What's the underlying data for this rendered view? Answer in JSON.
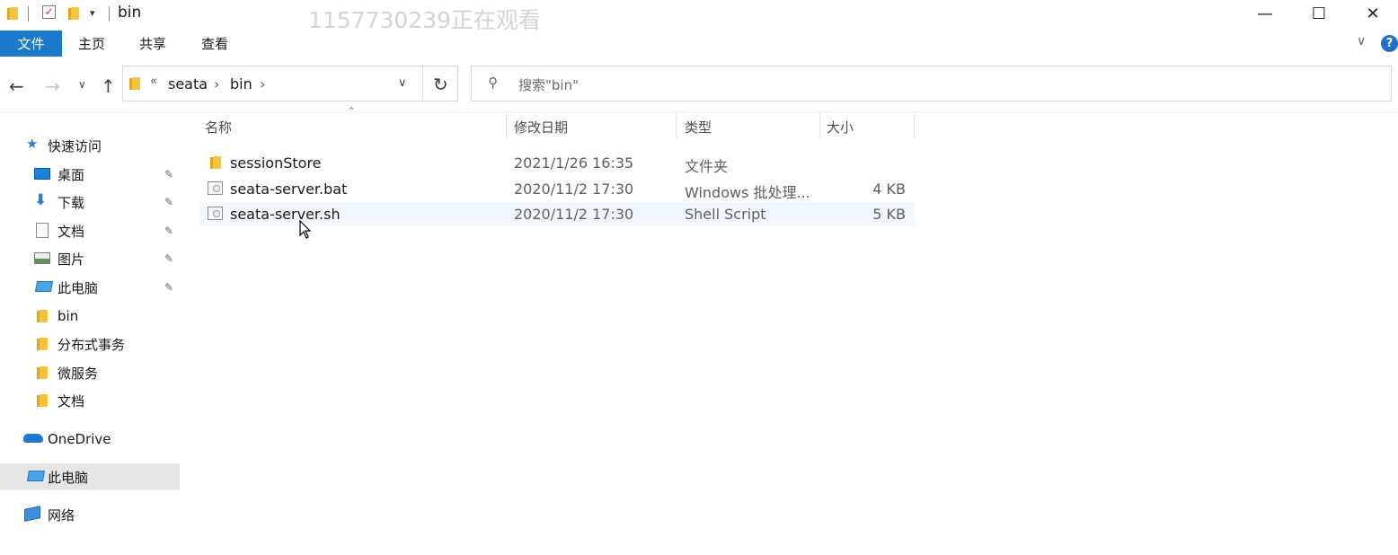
{
  "window": {
    "title": "bin",
    "watermark": "1157730239正在观看",
    "controls": {
      "minimize": "—",
      "maximize": "☐",
      "close": "✕"
    }
  },
  "ribbon": {
    "tabs": [
      {
        "label": "文件",
        "active": true
      },
      {
        "label": "主页"
      },
      {
        "label": "共享"
      },
      {
        "label": "查看"
      }
    ],
    "help": "?"
  },
  "addressbar": {
    "overflow": "«",
    "crumbs": [
      "seata",
      "bin"
    ],
    "separator": "›"
  },
  "search": {
    "placeholder": "搜索\"bin\""
  },
  "sidebar": {
    "quick_access": "快速访问",
    "items": [
      {
        "label": "桌面",
        "icon": "desktop-icon",
        "pinned": true
      },
      {
        "label": "下载",
        "icon": "download-icon",
        "pinned": true
      },
      {
        "label": "文档",
        "icon": "document-icon",
        "pinned": true
      },
      {
        "label": "图片",
        "icon": "picture-icon",
        "pinned": true
      },
      {
        "label": "此电脑",
        "icon": "computer-icon",
        "pinned": true
      },
      {
        "label": "bin",
        "icon": "folder-icon"
      },
      {
        "label": "分布式事务",
        "icon": "folder-icon"
      },
      {
        "label": "微服务",
        "icon": "folder-icon"
      },
      {
        "label": "文档",
        "icon": "folder-icon"
      }
    ],
    "onedrive": "OneDrive",
    "this_pc": "此电脑",
    "network": "网络"
  },
  "columns": {
    "name": "名称",
    "modified": "修改日期",
    "type": "类型",
    "size": "大小"
  },
  "files": [
    {
      "name": "sessionStore",
      "modified": "2021/1/26 16:35",
      "type": "文件夹",
      "size": "",
      "kind": "folder"
    },
    {
      "name": "seata-server.bat",
      "modified": "2020/11/2 17:30",
      "type": "Windows 批处理...",
      "size": "4 KB",
      "kind": "file"
    },
    {
      "name": "seata-server.sh",
      "modified": "2020/11/2 17:30",
      "type": "Shell Script",
      "size": "5 KB",
      "kind": "file",
      "hover": true
    }
  ],
  "colors": {
    "accent": "#1979ca",
    "folder": "#f3c53c",
    "hover_row": "#f1f8fd",
    "selected_nav": "#e5e5e5"
  }
}
